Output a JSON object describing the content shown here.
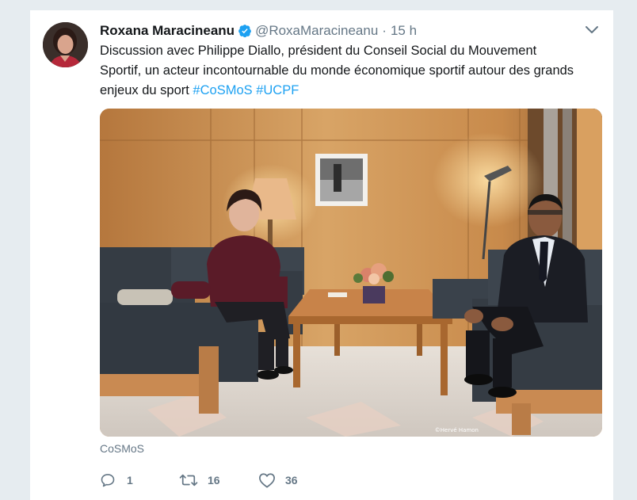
{
  "tweet": {
    "author_name": "Roxana Maracineanu",
    "handle": "@RoxaMaracineanu",
    "separator": "·",
    "time": "15 h",
    "text_main": "Discussion avec Philippe Diallo, président du Conseil Social du Mouvement Sportif, un acteur incontournable du monde économique sportif autour des grands enjeux du sport",
    "hashtags": [
      "#CoSMoS",
      "#UCPF"
    ],
    "photo_credit": "©Hervé Hamon",
    "tag_label": "CoSMoS"
  },
  "actions": {
    "reply_count": "1",
    "retweet_count": "16",
    "like_count": "36"
  },
  "colors": {
    "accent": "#1da1f2",
    "secondary_text": "#657786",
    "background": "#e6ecf0"
  },
  "icons": {
    "verified": "verified-badge-icon",
    "caret": "chevron-down-icon",
    "reply": "reply-bubble-icon",
    "retweet": "retweet-arrows-icon",
    "like": "heart-icon"
  }
}
